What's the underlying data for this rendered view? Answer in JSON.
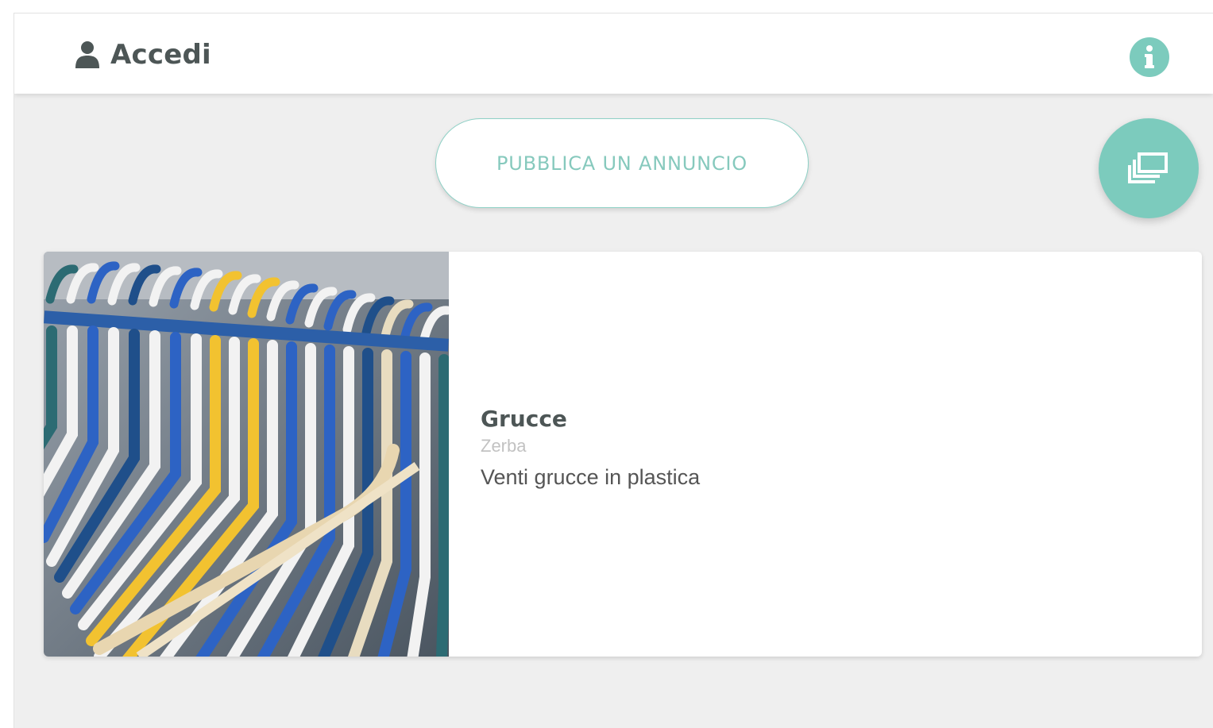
{
  "header": {
    "login_label": "Accedi",
    "login_icon": "user-icon",
    "info_icon": "info-icon"
  },
  "actions": {
    "publish_label": "PUBBLICA UN ANNUNCIO",
    "gallery_icon": "gallery-view-icon"
  },
  "listing": {
    "title": "Grucce",
    "location": "Zerba",
    "description": "Venti grucce in plastica",
    "image": "clothes-hangers-photo"
  },
  "colors": {
    "accent": "#7ccbbd",
    "accent_text": "#86c9bd",
    "heading_text": "#4d5656",
    "muted_text": "#c2c2c2",
    "background": "#efefef"
  }
}
